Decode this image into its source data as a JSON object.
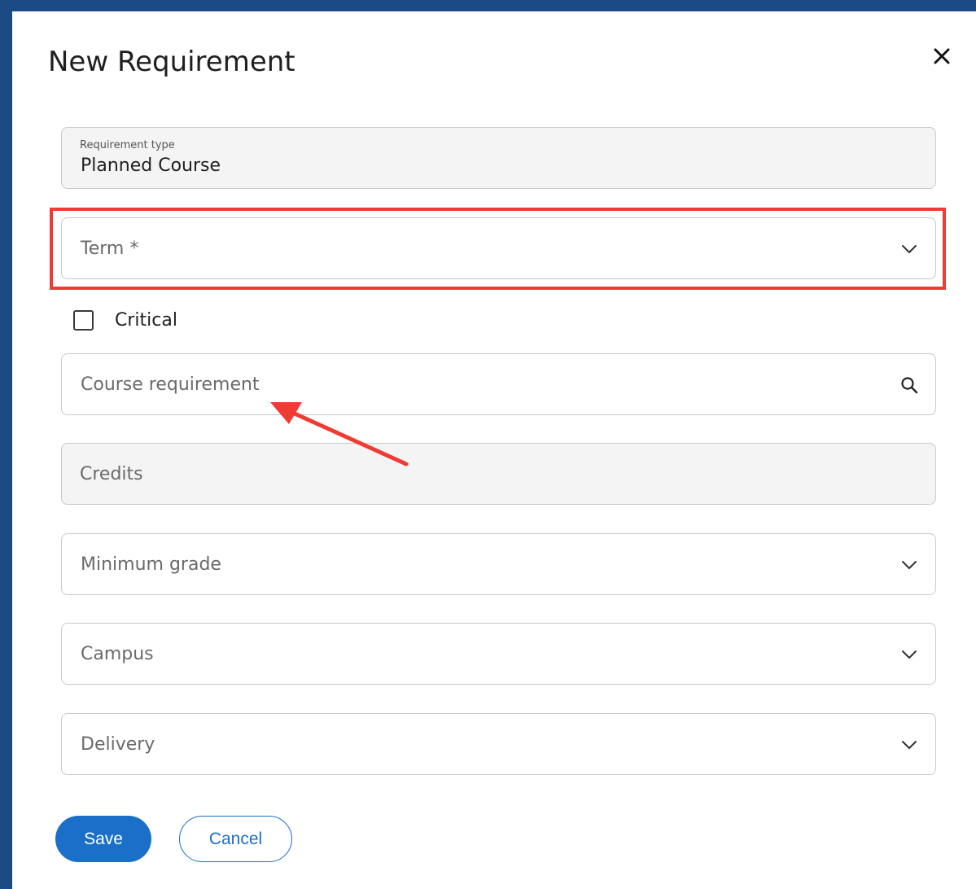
{
  "dialog": {
    "title": "New Requirement",
    "close_icon": "close-icon"
  },
  "fields": {
    "requirement_type": {
      "label": "Requirement type",
      "value": "Planned Course"
    },
    "term": {
      "placeholder": "Term *",
      "icon": "chevron-down-icon"
    },
    "critical": {
      "label": "Critical",
      "checked": false
    },
    "course_requirement": {
      "placeholder": "Course requirement",
      "icon": "search-icon"
    },
    "credits": {
      "placeholder": "Credits"
    },
    "minimum_grade": {
      "placeholder": "Minimum grade",
      "icon": "chevron-down-icon"
    },
    "campus": {
      "placeholder": "Campus",
      "icon": "chevron-down-icon"
    },
    "delivery": {
      "placeholder": "Delivery",
      "icon": "chevron-down-icon"
    }
  },
  "actions": {
    "save_label": "Save",
    "cancel_label": "Cancel"
  },
  "annotations": {
    "highlight_color": "#ef3b33",
    "arrow_color": "#ef3b33"
  },
  "colors": {
    "background": "#1b4a85",
    "primary": "#1a6fc8"
  }
}
